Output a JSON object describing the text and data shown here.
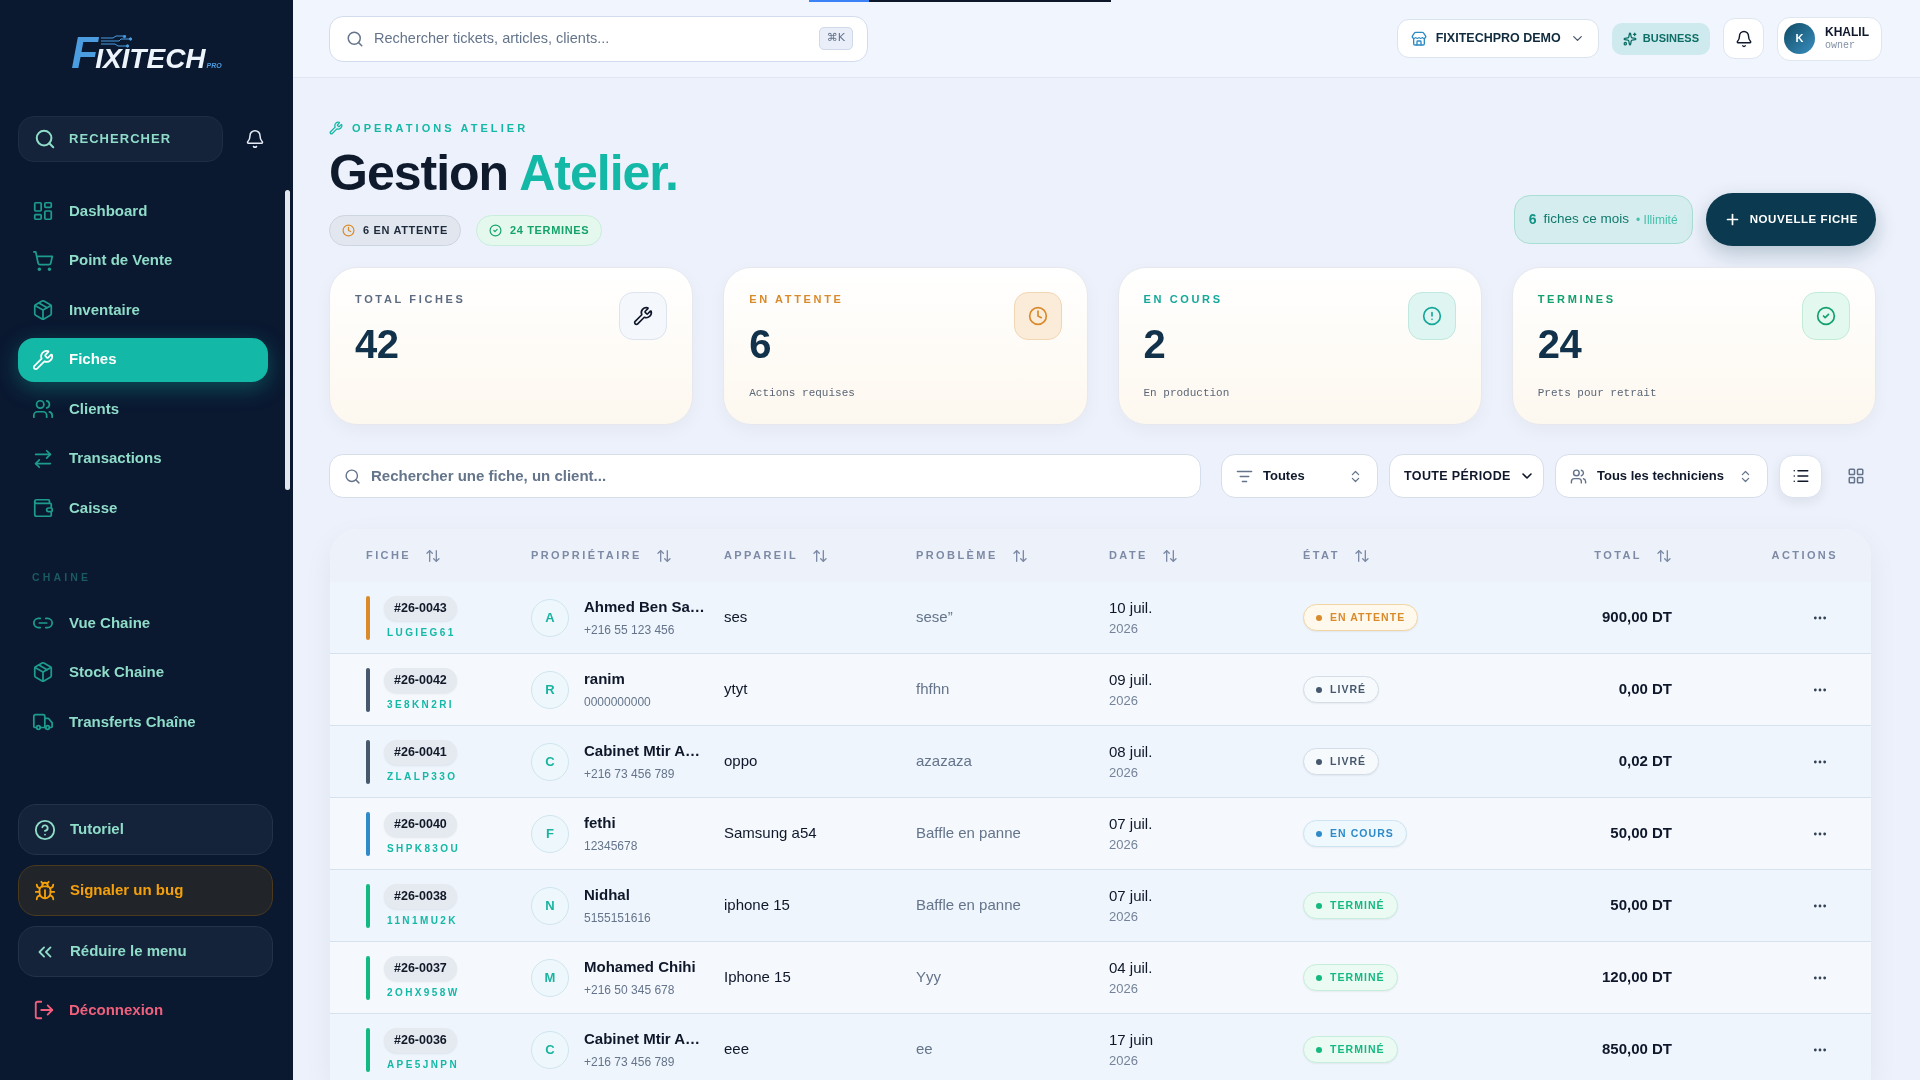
{
  "sidebar": {
    "logo": {
      "lead": "F",
      "text": "IXITECH",
      "suffix": "PRO"
    },
    "search_button": "RECHERCHER",
    "nav": [
      {
        "label": "Dashboard",
        "selected": false
      },
      {
        "label": "Point de Vente",
        "selected": false
      },
      {
        "label": "Inventaire",
        "selected": false
      },
      {
        "label": "Fiches",
        "selected": true
      },
      {
        "label": "Clients",
        "selected": false
      },
      {
        "label": "Transactions",
        "selected": false
      },
      {
        "label": "Caisse",
        "selected": false
      }
    ],
    "sections": [
      {
        "title": "CHAINE",
        "items": [
          {
            "label": "Vue Chaine",
            "selected": false
          },
          {
            "label": "Stock Chaine",
            "selected": false
          },
          {
            "label": "Transferts Chaîne",
            "selected": false
          }
        ]
      }
    ],
    "footer_buttons": [
      {
        "label": "Tutoriel",
        "kind": "help"
      },
      {
        "label": "Signaler un bug",
        "kind": "bug"
      },
      {
        "label": "Réduire le menu",
        "kind": "collapse"
      }
    ],
    "logout": "Déconnexion"
  },
  "topbar": {
    "loading": {
      "level": 0.2
    },
    "search": {
      "placeholder": "Rechercher tickets, articles, clients..."
    },
    "shortcut": "⌘K",
    "workspace": "FIXITECHPRO DEMO",
    "plan": "BUSINESS",
    "user": {
      "initial": "K",
      "name": "KHALIL",
      "role": "owner"
    }
  },
  "header": {
    "eyebrow": "OPERATIONS ATELIER",
    "title": "Gestion",
    "title_accent": "Atelier.",
    "chips": [
      {
        "label": "6 EN ATTENTE",
        "kind": "pending"
      },
      {
        "label": "24 TERMINES",
        "kind": "done"
      }
    ],
    "quota": {
      "count": "6",
      "label": "fiches ce mois",
      "note": "• Illimité"
    },
    "new_button": "NOUVELLE FICHE"
  },
  "stats": [
    {
      "label": "TOTAL FICHES",
      "value": "42",
      "kind": "total"
    },
    {
      "label": "EN ATTENTE",
      "value": "6",
      "caption": "Actions requises",
      "kind": "pending"
    },
    {
      "label": "EN COURS",
      "value": "2",
      "caption": "En production",
      "kind": "in_progress"
    },
    {
      "label": "TERMINES",
      "value": "24",
      "caption": "Prets pour retrait",
      "kind": "done"
    }
  ],
  "filters": {
    "search": {
      "placeholder": "Rechercher une fiche, un client..."
    },
    "status_select": "Toutes",
    "period_select": "TOUTE PÉRIODE",
    "technician_select": "Tous les techniciens",
    "views": [
      {
        "kind": "list",
        "selected": true
      },
      {
        "kind": "grid",
        "selected": false
      }
    ]
  },
  "table": {
    "columns": [
      {
        "label": "FICHE",
        "sortable": true
      },
      {
        "label": "PROPRIÉTAIRE",
        "sortable": true
      },
      {
        "label": "APPAREIL",
        "sortable": true
      },
      {
        "label": "PROBLÈME",
        "sortable": true
      },
      {
        "label": "DATE",
        "sortable": true
      },
      {
        "label": "ÉTAT",
        "sortable": true
      },
      {
        "label": "TOTAL",
        "sortable": true
      },
      {
        "label": "ACTIONS",
        "sortable": false
      }
    ],
    "rows": [
      {
        "ticket": "#26-0043",
        "code": "LUGIEG61",
        "owner": {
          "initial": "A",
          "name": "Ahmed Ben Sa…",
          "phone": "+216 55 123 456"
        },
        "device": "ses",
        "problem": "sese”",
        "date": "10 juil.",
        "year": "2026",
        "status": {
          "label": "EN ATTENTE",
          "kind": "pending"
        },
        "total": "900,00 DT"
      },
      {
        "ticket": "#26-0042",
        "code": "3E8KN2RI",
        "owner": {
          "initial": "R",
          "name": "ranim",
          "phone": "0000000000"
        },
        "device": "ytyt",
        "problem": "fhfhn",
        "date": "09 juil.",
        "year": "2026",
        "status": {
          "label": "LIVRÉ",
          "kind": "delivered"
        },
        "total": "0,00 DT"
      },
      {
        "ticket": "#26-0041",
        "code": "ZLALP33O",
        "owner": {
          "initial": "C",
          "name": "Cabinet Mtir A…",
          "phone": "+216 73 456 789"
        },
        "device": "oppo",
        "problem": "azazaza",
        "date": "08 juil.",
        "year": "2026",
        "status": {
          "label": "LIVRÉ",
          "kind": "delivered"
        },
        "total": "0,02 DT"
      },
      {
        "ticket": "#26-0040",
        "code": "SHPK83OU",
        "owner": {
          "initial": "F",
          "name": "fethi",
          "phone": "12345678"
        },
        "device": "Samsung a54",
        "problem": "Baffle en panne",
        "date": "07 juil.",
        "year": "2026",
        "status": {
          "label": "EN COURS",
          "kind": "in_progress"
        },
        "total": "50,00 DT"
      },
      {
        "ticket": "#26-0038",
        "code": "11N1MU2K",
        "owner": {
          "initial": "N",
          "name": "Nidhal",
          "phone": "5155151616"
        },
        "device": "iphone 15",
        "problem": "Baffle en panne",
        "date": "07 juil.",
        "year": "2026",
        "status": {
          "label": "TERMINÉ",
          "kind": "done"
        },
        "total": "50,00 DT"
      },
      {
        "ticket": "#26-0037",
        "code": "2OHX958W",
        "owner": {
          "initial": "M",
          "name": "Mohamed Chihi",
          "phone": "+216 50 345 678"
        },
        "device": "Iphone 15",
        "problem": "Yyy",
        "date": "04 juil.",
        "year": "2026",
        "status": {
          "label": "TERMINÉ",
          "kind": "done"
        },
        "total": "120,00 DT"
      },
      {
        "ticket": "#26-0036",
        "code": "APE5JNPN",
        "owner": {
          "initial": "C",
          "name": "Cabinet Mtir A…",
          "phone": "+216 73 456 789"
        },
        "device": "eee",
        "problem": "ee",
        "date": "17 juin",
        "year": "2026",
        "status": {
          "label": "TERMINÉ",
          "kind": "done"
        },
        "total": "850,00 DT"
      }
    ]
  }
}
